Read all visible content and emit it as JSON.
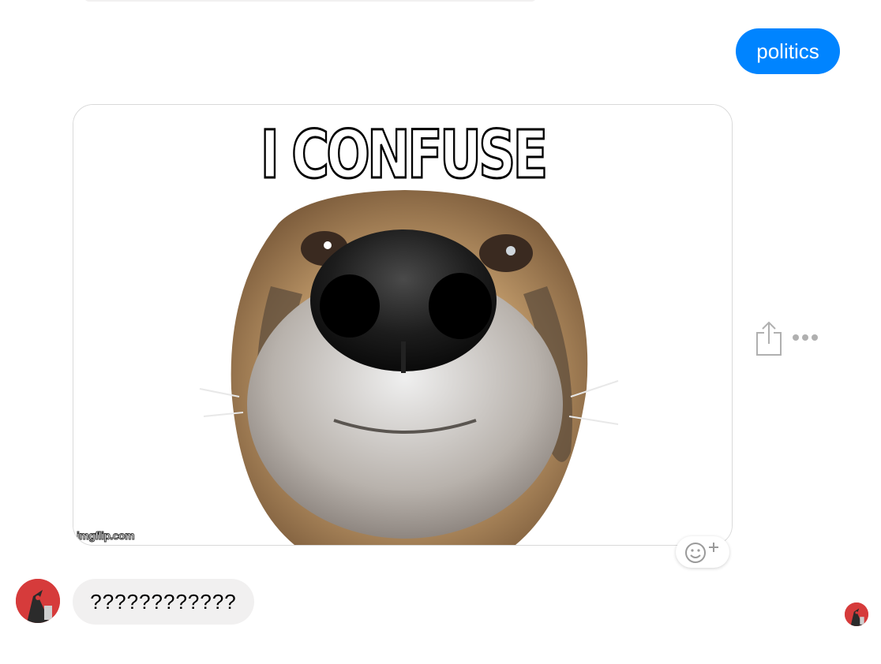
{
  "previous_message": {
    "text": ""
  },
  "sent_message": {
    "text": "politics",
    "color": "#0084ff"
  },
  "image_message": {
    "caption": "I CONFUSE",
    "watermark": "imgflip.com",
    "subject": "close-up of dog nose"
  },
  "actions": {
    "share_icon": "share-icon",
    "more_icon": "more-options-icon",
    "react_icon": "add-reaction-icon"
  },
  "received_message": {
    "text": "????????????"
  },
  "colors": {
    "sent_bubble": "#0084ff",
    "received_bubble": "#f1f0f0",
    "avatar": "#d63b3b"
  }
}
